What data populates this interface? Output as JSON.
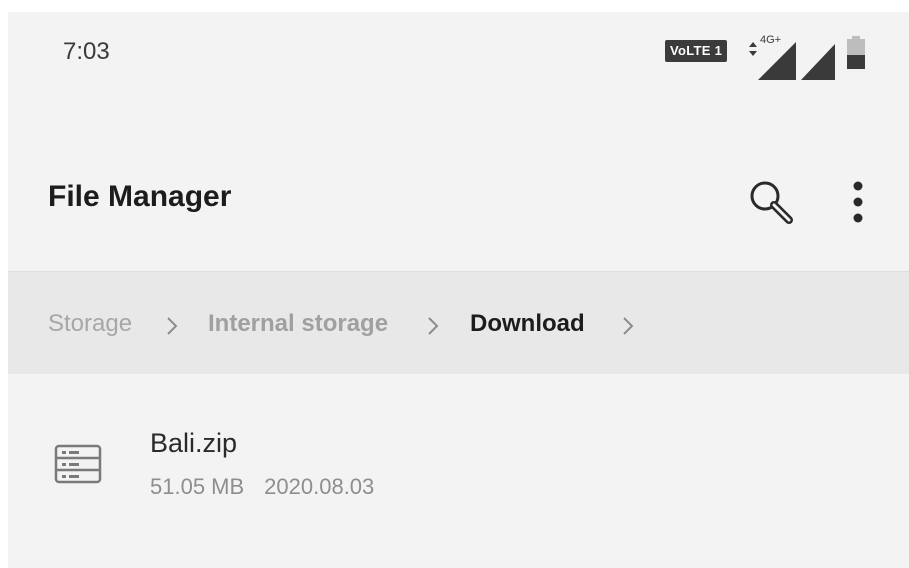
{
  "status_bar": {
    "time": "7:03",
    "volte_label": "VoLTE 1",
    "network_label": "4G+"
  },
  "toolbar": {
    "title": "File Manager",
    "search_icon": "search-icon",
    "menu_icon": "more-vert-icon"
  },
  "breadcrumb": {
    "items": [
      {
        "label": "Storage",
        "state": "inactive"
      },
      {
        "label": "Internal storage",
        "state": "inactive"
      },
      {
        "label": "Download",
        "state": "current"
      }
    ],
    "separator_icon": "chevron-right-icon"
  },
  "files": [
    {
      "name": "Bali.zip",
      "size": "51.05 MB",
      "date": "2020.08.03",
      "icon": "archive-file-icon"
    }
  ],
  "colors": {
    "background": "#f3f3f3",
    "breadcrumb_bg": "#e8e8e8",
    "title_text": "#1c1c1c",
    "secondary_text": "#8e8e8e"
  }
}
